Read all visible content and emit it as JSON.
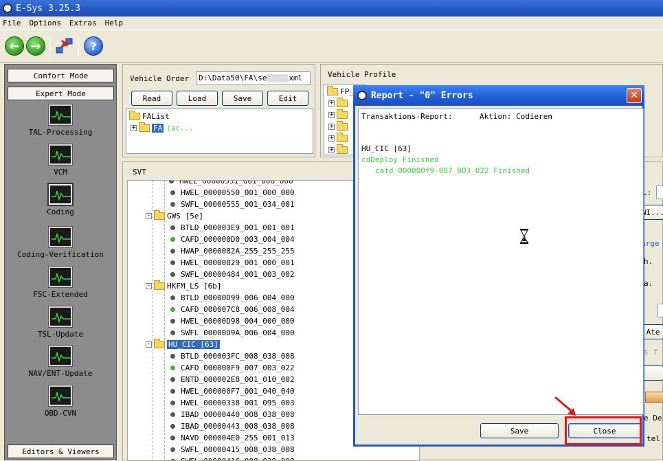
{
  "app": {
    "title": "E-Sys 3.25.3"
  },
  "menu": [
    "File",
    "Options",
    "Extras",
    "Help"
  ],
  "left": {
    "comfort_mode": "Comfort Mode",
    "expert_mode": "Expert Mode",
    "items": [
      "TAL-Processing",
      "VCM",
      "Coding",
      "Coding-Verification",
      "FSC-Extended",
      "TSL-Update",
      "NAV/ENT-Update",
      "OBD-CVN"
    ],
    "selected": "Coding",
    "editors_viewers": "Editors & Viewers"
  },
  "vehicle_order": {
    "label": "Vehicle Order",
    "path": "D:\\Data50\\FA\\se",
    "path_end": "xml",
    "buttons": [
      "Read",
      "Load",
      "Save",
      "Edit"
    ],
    "tree_root": "FAList",
    "tree_child": "FA",
    "tree_child_suffix": "(ac..."
  },
  "vehicle_profile": {
    "label": "Vehicle Profile",
    "root": "FP_V"
  },
  "svt": {
    "label": "SVT",
    "rows": [
      {
        "text": "HWEL_00000550_001_000_000",
        "level": 2,
        "type": "item",
        "dot": "gray"
      },
      {
        "text": "SWFL_00000555_001_034_001",
        "level": 2,
        "type": "item",
        "dot": "gray"
      },
      {
        "text": "GWS [5e]",
        "level": 1,
        "type": "folder"
      },
      {
        "text": "BTLD_000003E9_001_001_001",
        "level": 2,
        "type": "item",
        "dot": "gray"
      },
      {
        "text": "CAFD_000000D0_003_004_004",
        "level": 2,
        "type": "item",
        "dot": "green"
      },
      {
        "text": "HWAP_0000082A_255_255_255",
        "level": 2,
        "type": "item",
        "dot": "gray"
      },
      {
        "text": "HWEL_00000829_001_000_001",
        "level": 2,
        "type": "item",
        "dot": "gray"
      },
      {
        "text": "SWFL_00000484_001_003_002",
        "level": 2,
        "type": "item",
        "dot": "gray"
      },
      {
        "text": "HKFM_LS [6b]",
        "level": 1,
        "type": "folder"
      },
      {
        "text": "BTLD_00000D99_006_004_000",
        "level": 2,
        "type": "item",
        "dot": "gray"
      },
      {
        "text": "CAFD_000007C8_006_008_004",
        "level": 2,
        "type": "item",
        "dot": "green"
      },
      {
        "text": "HWEL_00000D98_004_000_000",
        "level": 2,
        "type": "item",
        "dot": "gray"
      },
      {
        "text": "SWFL_00000D9A_006_004_000",
        "level": 2,
        "type": "item",
        "dot": "gray"
      },
      {
        "text": "HU_CIC [63]",
        "level": 1,
        "type": "folder",
        "selected": true
      },
      {
        "text": "BTLD_000003FC_008_038_008",
        "level": 2,
        "type": "item",
        "dot": "gray"
      },
      {
        "text": "CAFD_000000F9_007_003_022",
        "level": 2,
        "type": "item",
        "dot": "green"
      },
      {
        "text": "ENTD_000002E8_001_010_002",
        "level": 2,
        "type": "item",
        "dot": "gray"
      },
      {
        "text": "HWEL_000000F7_001_040_040",
        "level": 2,
        "type": "item",
        "dot": "gray"
      },
      {
        "text": "HWEL_00000338_001_095_003",
        "level": 2,
        "type": "item",
        "dot": "gray"
      },
      {
        "text": "IBAD_00000440_008_038_008",
        "level": 2,
        "type": "item",
        "dot": "gray"
      },
      {
        "text": "IBAD_00000443_008_038_008",
        "level": 2,
        "type": "item",
        "dot": "gray"
      },
      {
        "text": "NAVD_000004E0_255_001_013",
        "level": 2,
        "type": "item",
        "dot": "gray"
      },
      {
        "text": "SWFL_00000415_008_038_008",
        "level": 2,
        "type": "item",
        "dot": "gray"
      },
      {
        "text": "SWFL_00000416_008_038_008",
        "level": 2,
        "type": "item",
        "dot": "gray"
      }
    ]
  },
  "right_strip": {
    "items": [
      "L:",
      "WI...",
      "arge",
      "h.",
      "a.",
      "Ate",
      "s f",
      "e De",
      "tel"
    ]
  },
  "report": {
    "title": "Report - \"0\" Errors",
    "header_left": "Transaktions-Report:",
    "header_right": "Aktion: Codieren",
    "ecu": "HU_CIC [63]",
    "line1": "cdDeploy Finished",
    "line2": "cafd_000000f9-007_003_022 Finished",
    "save": "Save",
    "close": "Close",
    "accent": "#3cd23c"
  }
}
